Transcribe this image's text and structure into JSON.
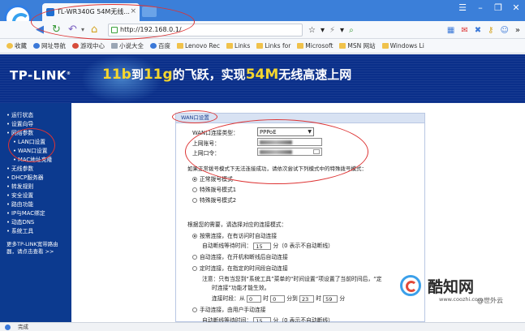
{
  "browser": {
    "tab_title": "TL-WR340G 54M无线...",
    "url": "http://192.168.0.1/",
    "window_controls": [
      "minimize",
      "restore",
      "close"
    ]
  },
  "bookmarks": [
    {
      "label": "收藏",
      "icon": "star-icon"
    },
    {
      "label": "网址导航",
      "icon": "globe-icon"
    },
    {
      "label": "游戏中心",
      "icon": "game-icon"
    },
    {
      "label": "小说大全",
      "icon": "book-icon"
    },
    {
      "label": "百度",
      "icon": "baidu-icon"
    },
    {
      "label": "Lenovo Rec",
      "icon": "folder-icon"
    },
    {
      "label": "Links",
      "icon": "folder-icon"
    },
    {
      "label": "Links for",
      "icon": "folder-icon"
    },
    {
      "label": "Microsoft",
      "icon": "folder-icon"
    },
    {
      "label": "MSN 网站",
      "icon": "folder-icon"
    },
    {
      "label": "Windows Li",
      "icon": "folder-icon"
    }
  ],
  "banner": {
    "brand": "TP-LINK",
    "slogan_a": "11b",
    "slogan_b": "到",
    "slogan_c": "11g",
    "slogan_d": "的飞跃，实现",
    "slogan_e": "54M",
    "slogan_f": "无线高速上网"
  },
  "sidebar": {
    "items": [
      {
        "label": "运行状态",
        "sub": false
      },
      {
        "label": "设置向导",
        "sub": false
      },
      {
        "label": "网络参数",
        "sub": false
      },
      {
        "label": "LAN口设置",
        "sub": true
      },
      {
        "label": "WAN口设置",
        "sub": true
      },
      {
        "label": "MAC地址克隆",
        "sub": true
      },
      {
        "label": "无线参数",
        "sub": false
      },
      {
        "label": "DHCP服务器",
        "sub": false
      },
      {
        "label": "转发规则",
        "sub": false
      },
      {
        "label": "安全设置",
        "sub": false
      },
      {
        "label": "路由功能",
        "sub": false
      },
      {
        "label": "IP与MAC绑定",
        "sub": false
      },
      {
        "label": "动态DNS",
        "sub": false
      },
      {
        "label": "系统工具",
        "sub": false
      }
    ],
    "hint": "更多TP-LINK宽带路由器，请点击查看 >>"
  },
  "wan": {
    "panel_title": "WAN口设置",
    "conn_type_label": "WAN口连接类型：",
    "conn_type_value": "PPPoE",
    "account_label": "上网账号：",
    "password_label": "上网口令：",
    "dial_note": "如果正常拨号模式下无法连接成功，请依次尝试下列模式中的特殊拨号模式：",
    "dial_modes": [
      "正常拨号模式",
      "特殊拨号模式1",
      "特殊拨号模式2"
    ],
    "dial_selected": 0,
    "conn_note": "根据您的需要，请选择对应的连接模式：",
    "conn_modes": [
      "按需连接，在有访问时自动连接",
      "自动连接，在开机和断线后自动连接",
      "定时连接，在指定的时间段自动连接",
      "手动连接，由用户手动连接"
    ],
    "conn_selected": 0,
    "idle_label": "自动断线等待时间：",
    "idle_value": "15",
    "idle_unit": "分（0 表示不自动断线）",
    "timer_note_a": "注意：只有当您到“系统工具”菜单的“时间设置”项设置了当前时间后，“定",
    "timer_note_b": "时连接”功能才能生效。",
    "timer_label": "连接时段：从",
    "timer_h1": "0",
    "timer_m_label": "时",
    "timer_m1": "0",
    "timer_to": "分到",
    "timer_h2": "23",
    "timer_h2_unit": "时",
    "timer_m2": "59",
    "timer_m2_unit": "分",
    "idle_label2": "自动断线等待时间：",
    "idle_value2": "15",
    "idle_unit2": "分（0 表示不自动断线）"
  },
  "watermark": {
    "name": "酷知网",
    "url": "www.coozhi.com",
    "publisher": "@世外云"
  },
  "statusbar": {
    "text": "完成"
  },
  "colors": {
    "browser_blue": "#3b7fd9",
    "banner_blue": "#0a2f8a",
    "sidebar_blue": "#0c3a8f",
    "annotation_red": "#dd3333",
    "slogan_yellow": "#f4d62e"
  }
}
